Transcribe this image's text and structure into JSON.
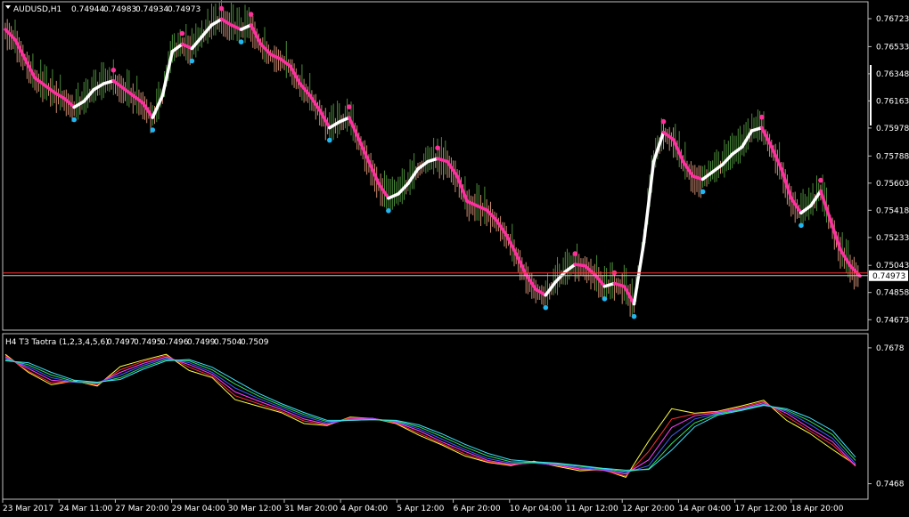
{
  "main": {
    "symbol": "AUDUSD,H1",
    "ohlc": [
      "0.74944",
      "0.74983",
      "0.74934",
      "0.74973"
    ],
    "menu_icon": "triangle-down-icon",
    "current_price": "0.74973"
  },
  "indicator": {
    "label": "H4 T3 Taotra (1,2,3,4,5,6)",
    "values": [
      "0.7497",
      "0.7495",
      "0.7496",
      "0.7499",
      "0.7504",
      "0.7509"
    ]
  },
  "colors": {
    "background": "#000000",
    "grid_frame": "#c0c0c0",
    "bull_bar": "#4a8a3a",
    "bear_bar": "#c98a70",
    "trend_up": "#ffffff",
    "trend_down": "#ff2fa0",
    "dot_high": "#ff2f9a",
    "dot_low": "#21b6f0",
    "price_line": "#ff3030",
    "bid_line": "#c0c0c0"
  },
  "chart_data": [
    {
      "type": "line",
      "title": "AUDUSD,H1",
      "ylim": [
        0.7462,
        0.7682
      ],
      "y_ticks": [
        "0.76723",
        "0.76533",
        "0.76348",
        "0.76163",
        "0.75978",
        "0.75788",
        "0.75603",
        "0.75418",
        "0.75233",
        "0.75043",
        "0.74858",
        "0.74673"
      ],
      "x_ticks": [
        "23 Mar 2017",
        "24 Mar 11:00",
        "27 Mar 20:00",
        "29 Mar 04:00",
        "30 Mar 12:00",
        "31 Mar 20:00",
        "4 Apr 04:00",
        "5 Apr 12:00",
        "6 Apr 20:00",
        "10 Apr 04:00",
        "11 Apr 12:00",
        "12 Apr 20:00",
        "14 Apr 04:00",
        "17 Apr 12:00",
        "18 Apr 20:00"
      ],
      "current_price": 0.74973,
      "series": [
        {
          "values": [
            0.7665,
            0.7658,
            0.7645,
            0.7632,
            0.7627,
            0.7622,
            0.7618,
            0.7612,
            0.7616,
            0.7624,
            0.7628,
            0.763,
            0.7625,
            0.762,
            0.7615,
            0.7605,
            0.762,
            0.765,
            0.7655,
            0.7652,
            0.766,
            0.7668,
            0.7672,
            0.7668,
            0.7665,
            0.7668,
            0.7655,
            0.7648,
            0.7645,
            0.764,
            0.7628,
            0.762,
            0.761,
            0.7598,
            0.7602,
            0.7605,
            0.759,
            0.7575,
            0.756,
            0.755,
            0.7553,
            0.756,
            0.757,
            0.7575,
            0.7577,
            0.7575,
            0.7565,
            0.7548,
            0.7545,
            0.7542,
            0.7535,
            0.7525,
            0.7512,
            0.7498,
            0.7488,
            0.7484,
            0.7493,
            0.75,
            0.7505,
            0.7504,
            0.7498,
            0.749,
            0.7492,
            0.749,
            0.7478,
            0.752,
            0.7575,
            0.7595,
            0.759,
            0.7575,
            0.7565,
            0.7563,
            0.7568,
            0.7573,
            0.758,
            0.7585,
            0.7596,
            0.7598,
            0.7585,
            0.757,
            0.755,
            0.754,
            0.7545,
            0.7555,
            0.7535,
            0.7515,
            0.7504,
            0.7497
          ]
        }
      ]
    },
    {
      "type": "line",
      "title": "H4 T3 Taotra (1,2,3,4,5,6)",
      "ylim": [
        0.7462,
        0.7682
      ],
      "y_ticks": [
        "0.7678",
        "0.7468"
      ],
      "series": [
        {
          "name": "T3(1)",
          "color": "#ffff40",
          "values": [
            0.7668,
            0.764,
            0.7621,
            0.7627,
            0.7619,
            0.7649,
            0.7659,
            0.7668,
            0.7643,
            0.7632,
            0.7598,
            0.7588,
            0.7578,
            0.7561,
            0.7558,
            0.7571,
            0.7569,
            0.7561,
            0.7543,
            0.7528,
            0.7511,
            0.7501,
            0.7496,
            0.7503,
            0.7495,
            0.7488,
            0.749,
            0.7478,
            0.7534,
            0.7584,
            0.7577,
            0.758,
            0.7588,
            0.7597,
            0.7566,
            0.7546,
            0.7521,
            0.7497
          ]
        },
        {
          "name": "T3(2)",
          "color": "#ff3030",
          "values": [
            0.7666,
            0.7642,
            0.7624,
            0.7626,
            0.7621,
            0.7644,
            0.7657,
            0.7666,
            0.7648,
            0.7634,
            0.7604,
            0.7592,
            0.758,
            0.7565,
            0.7559,
            0.757,
            0.7569,
            0.7562,
            0.7546,
            0.753,
            0.7514,
            0.7502,
            0.7497,
            0.7501,
            0.7496,
            0.749,
            0.7489,
            0.748,
            0.7518,
            0.7568,
            0.7576,
            0.7579,
            0.7586,
            0.7595,
            0.7572,
            0.755,
            0.7528,
            0.7495
          ]
        },
        {
          "name": "T3(3)",
          "color": "#ff40ff",
          "values": [
            0.7664,
            0.7646,
            0.7628,
            0.7625,
            0.7623,
            0.764,
            0.7654,
            0.7664,
            0.7652,
            0.7637,
            0.761,
            0.7596,
            0.7583,
            0.7568,
            0.756,
            0.7568,
            0.7569,
            0.7563,
            0.755,
            0.7533,
            0.7518,
            0.7504,
            0.7498,
            0.75,
            0.7497,
            0.7491,
            0.7489,
            0.7483,
            0.7505,
            0.7555,
            0.7573,
            0.7578,
            0.7584,
            0.7593,
            0.7577,
            0.7554,
            0.7533,
            0.7496
          ]
        },
        {
          "name": "T3(4)",
          "color": "#4060ff",
          "values": [
            0.7662,
            0.7649,
            0.7632,
            0.7625,
            0.7624,
            0.7636,
            0.7651,
            0.7662,
            0.7655,
            0.764,
            0.7616,
            0.76,
            0.7586,
            0.7572,
            0.7562,
            0.7567,
            0.7568,
            0.7564,
            0.7553,
            0.7537,
            0.7521,
            0.7507,
            0.75,
            0.75,
            0.7498,
            0.7493,
            0.749,
            0.7485,
            0.7496,
            0.7542,
            0.7568,
            0.7577,
            0.7583,
            0.7591,
            0.758,
            0.756,
            0.7538,
            0.7499
          ]
        },
        {
          "name": "T3(5)",
          "color": "#30e060",
          "values": [
            0.766,
            0.7652,
            0.7636,
            0.7626,
            0.7624,
            0.7632,
            0.7648,
            0.766,
            0.7658,
            0.7644,
            0.7622,
            0.7604,
            0.7589,
            0.7575,
            0.7564,
            0.7566,
            0.7567,
            0.7565,
            0.7556,
            0.7541,
            0.7525,
            0.7511,
            0.7502,
            0.7501,
            0.7499,
            0.7495,
            0.7491,
            0.7487,
            0.7491,
            0.753,
            0.7562,
            0.7576,
            0.7582,
            0.759,
            0.7582,
            0.7565,
            0.7544,
            0.7504
          ]
        },
        {
          "name": "T3(6)",
          "color": "#40e0ff",
          "values": [
            0.7658,
            0.7655,
            0.764,
            0.7628,
            0.7625,
            0.7629,
            0.7645,
            0.7658,
            0.766,
            0.7648,
            0.7628,
            0.7608,
            0.7592,
            0.7578,
            0.7566,
            0.7566,
            0.7567,
            0.7566,
            0.7559,
            0.7545,
            0.7529,
            0.7515,
            0.7505,
            0.7502,
            0.75,
            0.7496,
            0.7492,
            0.7489,
            0.749,
            0.752,
            0.7556,
            0.7574,
            0.7581,
            0.7589,
            0.7584,
            0.757,
            0.755,
            0.7509
          ]
        }
      ]
    }
  ]
}
